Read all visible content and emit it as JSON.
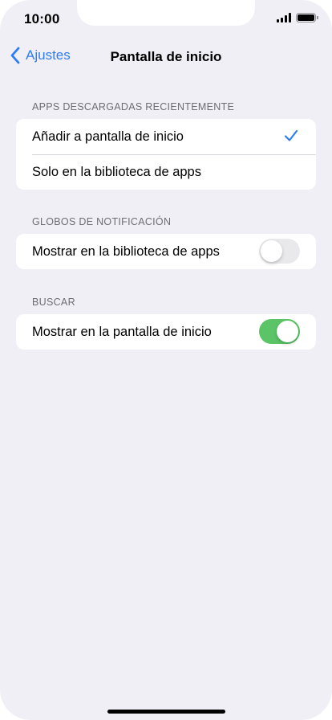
{
  "status_bar": {
    "time": "10:00"
  },
  "nav": {
    "back_label": "Ajustes",
    "title": "Pantalla de inicio"
  },
  "sections": [
    {
      "header": "APPS DESCARGADAS RECIENTEMENTE",
      "rows": [
        {
          "label": "Añadir a pantalla de inicio",
          "selected": true
        },
        {
          "label": "Solo en la biblioteca de apps",
          "selected": false
        }
      ]
    },
    {
      "header": "GLOBOS DE NOTIFICACIÓN",
      "rows": [
        {
          "label": "Mostrar en la biblioteca de apps",
          "toggle": false
        }
      ]
    },
    {
      "header": "BUSCAR",
      "rows": [
        {
          "label": "Mostrar en la pantalla de inicio",
          "toggle": true
        }
      ]
    }
  ],
  "colors": {
    "accent": "#2e7cf6",
    "toggle_on": "#5ac467",
    "background": "#f0eff5"
  }
}
